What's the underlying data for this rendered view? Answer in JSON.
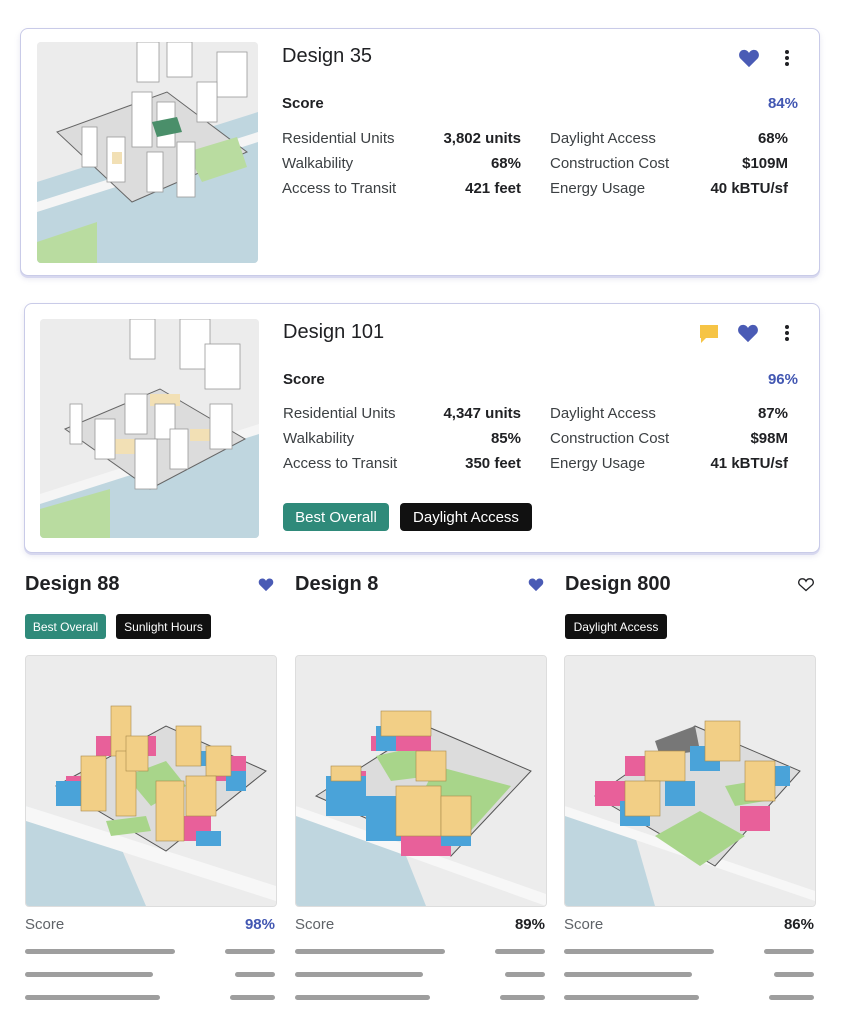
{
  "cards": [
    {
      "title": "Design 35",
      "score_label": "Score",
      "score_value": "84%",
      "favorited": true,
      "has_comment": false,
      "metrics_left": [
        {
          "label": "Residential Units",
          "value": "3,802 units"
        },
        {
          "label": "Walkability",
          "value": "68%"
        },
        {
          "label": "Access to Transit",
          "value": "421 feet"
        }
      ],
      "metrics_right": [
        {
          "label": "Daylight Access",
          "value": "68%"
        },
        {
          "label": "Construction Cost",
          "value": "$109M"
        },
        {
          "label": "Energy Usage",
          "value": "40 kBTU/sf"
        }
      ],
      "tags": []
    },
    {
      "title": "Design 101",
      "score_label": "Score",
      "score_value": "96%",
      "favorited": true,
      "has_comment": true,
      "metrics_left": [
        {
          "label": "Residential Units",
          "value": "4,347 units"
        },
        {
          "label": "Walkability",
          "value": "85%"
        },
        {
          "label": "Access to Transit",
          "value": "350 feet"
        }
      ],
      "metrics_right": [
        {
          "label": "Daylight Access",
          "value": "87%"
        },
        {
          "label": "Construction Cost",
          "value": "$98M"
        },
        {
          "label": "Energy Usage",
          "value": "41 kBTU/sf"
        }
      ],
      "tags": [
        "Best Overall",
        "Daylight Access"
      ]
    }
  ],
  "grid": [
    {
      "title": "Design 88",
      "favorited": true,
      "tags": [
        "Best Overall",
        "Sunlight Hours"
      ],
      "score_label": "Score",
      "score_value": "98%",
      "score_color": "#4257b2"
    },
    {
      "title": "Design 8",
      "favorited": true,
      "tags": [],
      "score_label": "Score",
      "score_value": "89%",
      "score_color": "#202124"
    },
    {
      "title": "Design 800",
      "favorited": false,
      "tags": [
        "Daylight Access"
      ],
      "score_label": "Score",
      "score_value": "86%",
      "score_color": "#202124"
    }
  ],
  "colors": {
    "accent": "#4257b2",
    "heart": "#4a5bb5",
    "comment": "#f6c445",
    "tag_teal": "#2f8a7a",
    "tag_black": "#111111",
    "residential": "#f2cf86",
    "commercial": "#e8609a",
    "parking": "#4aa3d9",
    "green": "#a8d58a"
  },
  "icons": {
    "favorite": "heart-filled-icon",
    "not_favorite": "heart-outline-icon",
    "more": "more-vert-icon",
    "comment": "comment-icon"
  }
}
